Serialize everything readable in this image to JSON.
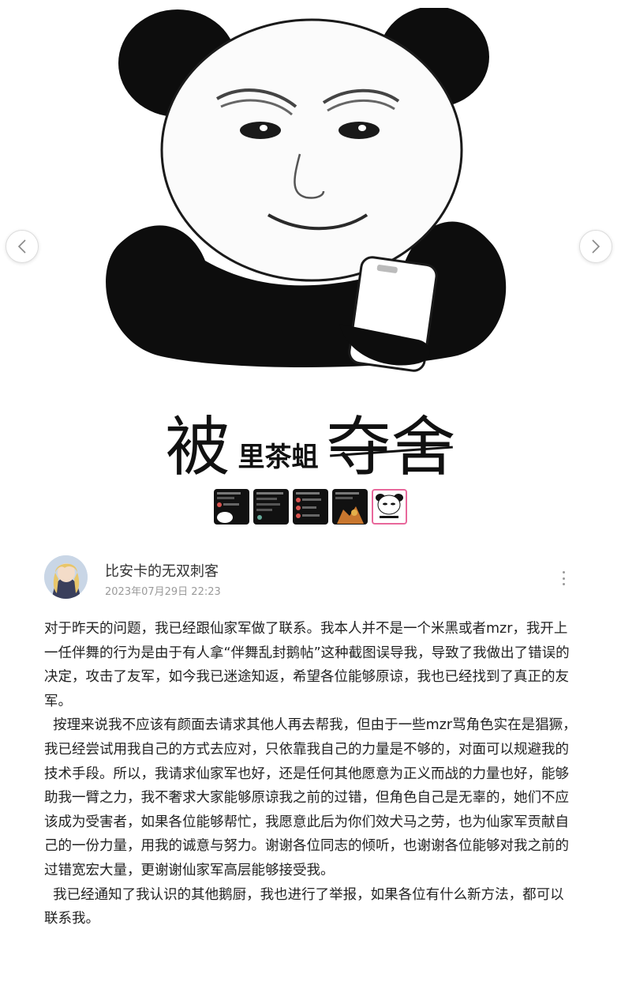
{
  "carousel": {
    "caption": {
      "part1": "被",
      "part2": "里茶蛆",
      "part3": "夺舍"
    },
    "prev_icon": "chevron-left-icon",
    "next_icon": "chevron-right-icon",
    "thumbnail_count": 5,
    "active_index": 4,
    "active_border_color": "#e8679b"
  },
  "author": {
    "name": "比安卡的无双刺客",
    "time": "2023年07月29日 22:23",
    "more_icon": "more-vertical-icon"
  },
  "post": {
    "paragraphs": [
      "对于昨天的问题，我已经跟仙家军做了联系。我本人并不是一个米黑或者mzr，我开上一任伴舞的行为是由于有人拿“伴舞乱封鹅帖”这种截图误导我，导致了我做出了错误的决定，攻击了友军，如今我已迷途知返，希望各位能够原谅，我也已经找到了真正的友军。",
      "  按理来说我不应该有颜面去请求其他人再去帮我，但由于一些mzr骂角色实在是猖獗，我已经尝试用我自己的方式去应对，只依靠我自己的力量是不够的，对面可以规避我的技术手段。所以，我请求仙家军也好，还是任何其他愿意为正义而战的力量也好，能够助我一臂之力，我不奢求大家能够原谅我之前的过错，但角色自己是无辜的，她们不应该成为受害者，如果各位能够帮忙，我愿意此后为你们效犬马之劳，也为仙家军贡献自己的一份力量，用我的诚意与努力。谢谢各位同志的倾听，也谢谢各位能够对我之前的过错宽宏大量，更谢谢仙家军高层能够接受我。",
      "  我已经通知了我认识的其他鹅厨，我也进行了举报，如果各位有什么新方法，都可以联系我。"
    ]
  }
}
